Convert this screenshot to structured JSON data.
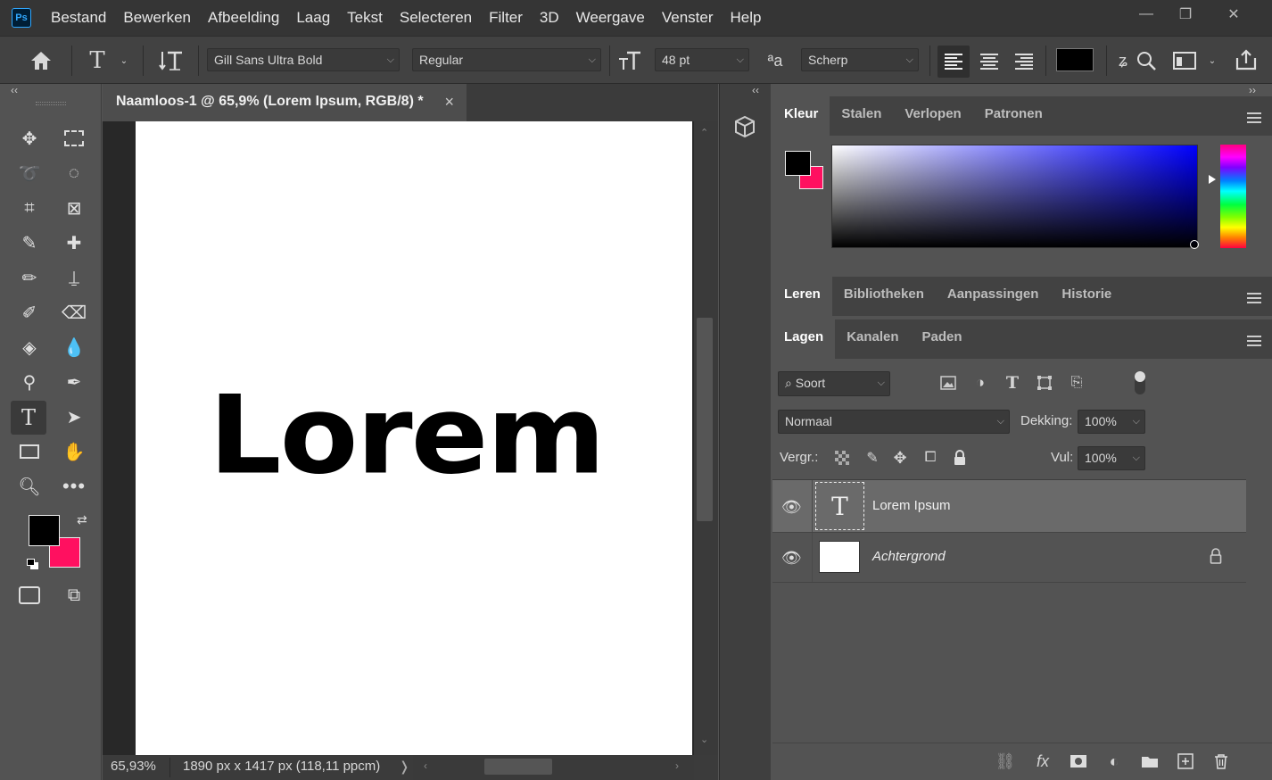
{
  "app": {
    "logo": "Ps"
  },
  "menu": [
    "Bestand",
    "Bewerken",
    "Afbeelding",
    "Laag",
    "Tekst",
    "Selecteren",
    "Filter",
    "3D",
    "Weergave",
    "Venster",
    "Help"
  ],
  "window_controls": {
    "minimize": "—",
    "maximize": "❐",
    "close": "✕"
  },
  "options": {
    "font_family": "Gill Sans Ultra Bold",
    "font_style": "Regular",
    "font_size": "48 pt",
    "aa_label": "ªa",
    "antialias": "Scherp",
    "text_color": "#000000"
  },
  "document": {
    "tab_title": "Naamloos-1 @ 65,9% (Lorem Ipsum, RGB/8) *",
    "close": "×",
    "canvas_text": "Lorem",
    "zoom": "65,93%",
    "dimensions": "1890 px x 1417 px (118,11 ppcm)",
    "status_arrow": "❭"
  },
  "colors": {
    "foreground": "#000000",
    "background": "#ff1060"
  },
  "color_panel": {
    "tabs": [
      "Kleur",
      "Stalen",
      "Verlopen",
      "Patronen"
    ]
  },
  "learn_panel": {
    "tabs": [
      "Leren",
      "Bibliotheken",
      "Aanpassingen",
      "Historie"
    ]
  },
  "layers_panel": {
    "tabs": [
      "Lagen",
      "Kanalen",
      "Paden"
    ],
    "filter": "Soort",
    "blend_mode": "Normaal",
    "opacity_label": "Dekking:",
    "opacity": "100%",
    "lock_label": "Vergr.:",
    "fill_label": "Vul:",
    "fill": "100%",
    "layers": [
      {
        "name": "Lorem Ipsum",
        "thumb": "T"
      },
      {
        "name": "Achtergrond"
      }
    ]
  },
  "collapse": {
    "left": "‹‹",
    "mid": "‹‹",
    "right": "››"
  }
}
